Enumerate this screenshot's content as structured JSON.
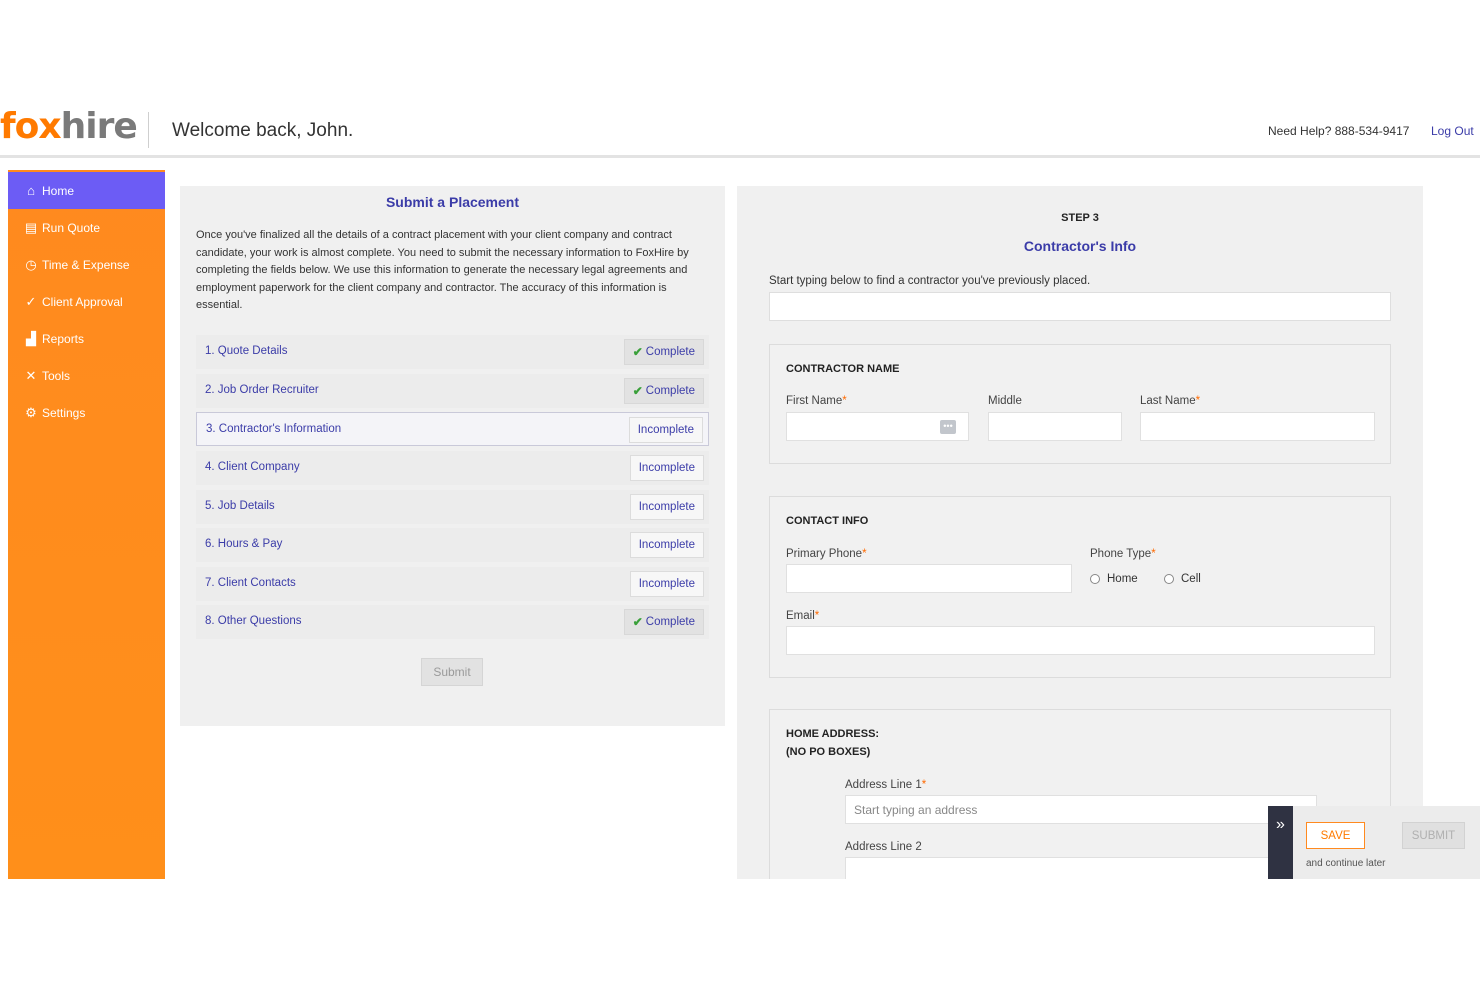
{
  "header": {
    "logo_fox": "fox",
    "logo_hire": "hire",
    "welcome": "Welcome back, John.",
    "help": "Need Help? 888-534-9417",
    "logout": "Log Out"
  },
  "sidebar": {
    "items": [
      {
        "label": "Home",
        "icon": "home-icon",
        "active": true
      },
      {
        "label": "Run Quote",
        "icon": "document-icon"
      },
      {
        "label": "Time & Expense",
        "icon": "clock-icon"
      },
      {
        "label": "Client Approval",
        "icon": "check-icon"
      },
      {
        "label": "Reports",
        "icon": "bar-chart-icon"
      },
      {
        "label": "Tools",
        "icon": "tools-icon"
      },
      {
        "label": "Settings",
        "icon": "gear-icon"
      }
    ]
  },
  "placement": {
    "title": "Submit a Placement",
    "intro": "Once you've finalized all the details of a contract placement with your client company and contract candidate, your work is almost complete. You need to submit the necessary information to FoxHire by completing the fields below. We use this information to generate the necessary legal agreements and employment paperwork for the client company and contractor. The accuracy of this information is essential.",
    "steps": [
      {
        "label": "1. Quote Details",
        "status": "Complete"
      },
      {
        "label": "2. Job Order Recruiter",
        "status": "Complete"
      },
      {
        "label": "3. Contractor's Information",
        "status": "Incomplete"
      },
      {
        "label": "4. Client Company",
        "status": "Incomplete"
      },
      {
        "label": "5. Job Details",
        "status": "Incomplete"
      },
      {
        "label": "6. Hours & Pay",
        "status": "Incomplete"
      },
      {
        "label": "7. Client Contacts",
        "status": "Incomplete"
      },
      {
        "label": "8. Other Questions",
        "status": "Complete"
      }
    ],
    "submit": "Submit"
  },
  "contractor": {
    "step": "STEP 3",
    "title": "Contractor's Info",
    "search_hint": "Start typing below to find a contractor you've previously placed.",
    "name_section": {
      "title": "CONTRACTOR NAME",
      "first": "First Name",
      "middle": "Middle",
      "last": "Last Name"
    },
    "contact_section": {
      "title": "CONTACT INFO",
      "phone": "Primary Phone",
      "phone_type": "Phone Type",
      "opt_home": "Home",
      "opt_cell": "Cell",
      "email": "Email"
    },
    "address_section": {
      "title_1": "HOME ADDRESS:",
      "title_2": "(NO PO BOXES)",
      "line1": "Address Line 1",
      "line1_placeholder": "Start typing an address",
      "line2": "Address Line 2"
    },
    "required_mark": "*"
  },
  "float_bar": {
    "save": "SAVE",
    "submit": "SUBMIT",
    "later": "and continue later"
  },
  "colors": {
    "brand_orange": "#ff8a1f",
    "active_purple": "#6c5cf5",
    "link_blue": "#3b3ca8",
    "complete_green": "#3aa03a"
  }
}
